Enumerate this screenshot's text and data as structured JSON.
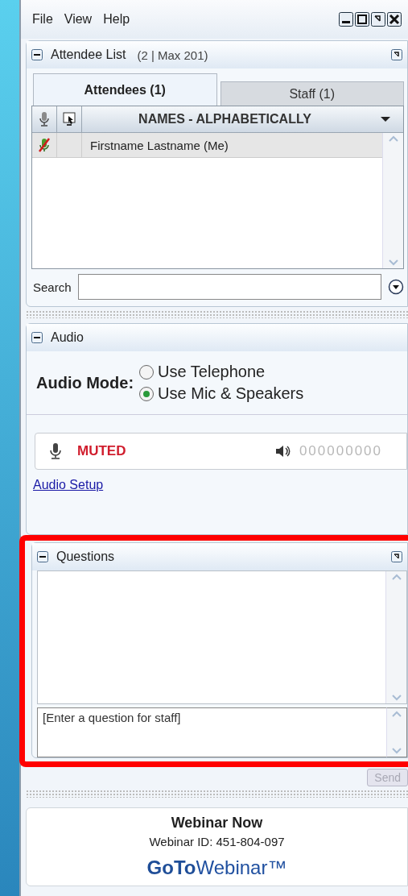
{
  "menu": [
    {
      "label": "File"
    },
    {
      "label": "View"
    },
    {
      "label": "Help"
    }
  ],
  "attendee_panel": {
    "title": "Attendee List",
    "count": "(2 | Max 201)",
    "expanded": true,
    "tabs": [
      {
        "label": "Attendees (1)",
        "selected": true
      },
      {
        "label": "Staff (1)",
        "selected": false
      }
    ],
    "column_header": "NAMES - ALPHABETICALLY",
    "rows": [
      {
        "name": "Firstname Lastname (Me)",
        "muted": true
      }
    ],
    "search": {
      "label": "Search"
    }
  },
  "audio_panel": {
    "title": "Audio",
    "expanded": true,
    "mode_label": "Audio Mode:",
    "options": [
      {
        "label": "Use Telephone",
        "selected": false
      },
      {
        "label": "Use Mic & Speakers",
        "selected": true
      }
    ],
    "mic_status": "MUTED",
    "speaker_reading": "000000000",
    "setup_link": "Audio Setup"
  },
  "questions_panel": {
    "title": "Questions",
    "expanded": true,
    "highlighted": true,
    "placeholder": "[Enter a question for staff]",
    "send_button": {
      "label": "Send",
      "disabled": true
    }
  },
  "footer": {
    "title": "Webinar Now",
    "webinar_id": "Webinar ID: 451-804-097",
    "logo": "**GoTo**Webinar™"
  }
}
